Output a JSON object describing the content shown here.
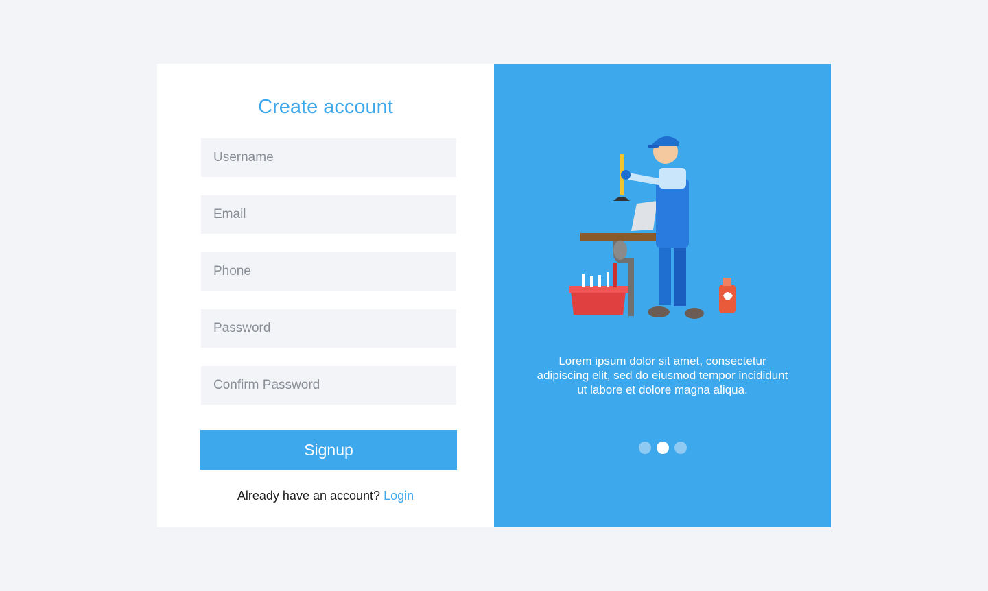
{
  "form": {
    "title": "Create account",
    "fields": [
      {
        "placeholder": "Username"
      },
      {
        "placeholder": "Email"
      },
      {
        "placeholder": "Phone"
      },
      {
        "placeholder": "Password"
      },
      {
        "placeholder": "Confirm Password"
      }
    ],
    "signup_label": "Signup",
    "login_prompt": "Already have an account?",
    "login_link": "Login"
  },
  "promo": {
    "text": "Lorem ipsum dolor sit amet, consectetur adipiscing elit, sed do eiusmod tempor incididunt ut labore et dolore magna aliqua.",
    "carousel": {
      "total": 3,
      "active_index": 1
    },
    "illustration": "plumber-illustration"
  },
  "colors": {
    "accent": "#3ea8ec",
    "background": "#f3f4f8",
    "field_background": "#f3f4f8",
    "dot_inactive": "#8fcaf3",
    "dot_active": "#ffffff"
  }
}
